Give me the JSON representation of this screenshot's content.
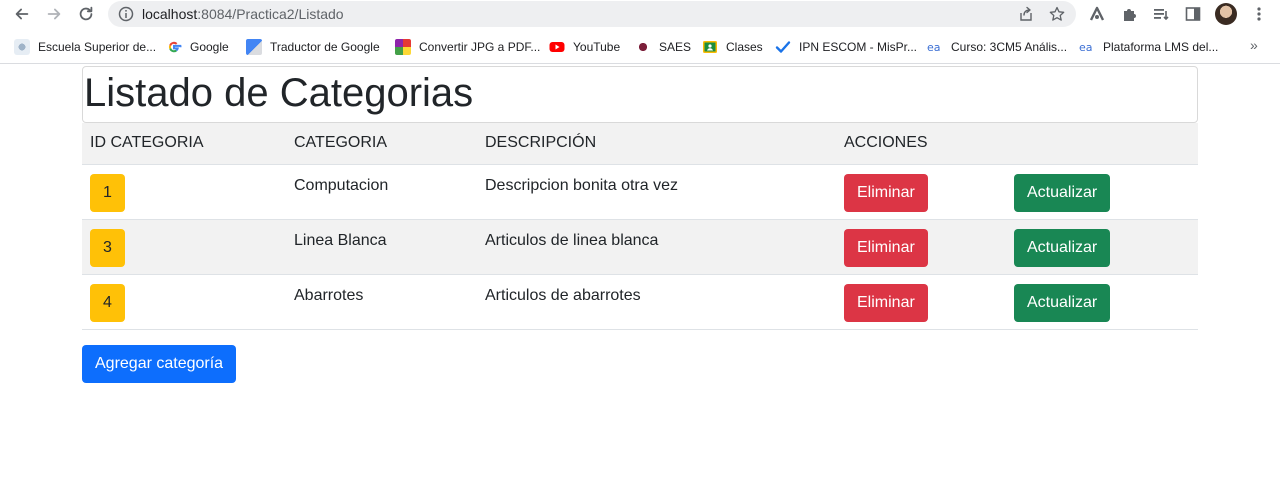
{
  "browser": {
    "url_host": "localhost",
    "url_path": ":8084/Practica2/Listado"
  },
  "bookmarks": [
    {
      "label": "Escuela Superior de..."
    },
    {
      "label": "Google"
    },
    {
      "label": "Traductor de Google"
    },
    {
      "label": "Convertir JPG a PDF..."
    },
    {
      "label": "YouTube"
    },
    {
      "label": "SAES"
    },
    {
      "label": "Clases"
    },
    {
      "label": "IPN ESCOM - MisPr..."
    },
    {
      "label": "Curso: 3CM5 Anális..."
    },
    {
      "label": "Plataforma LMS del..."
    }
  ],
  "bookmarks_more": "»",
  "page": {
    "title": "Listado de Categorias",
    "columns": [
      "ID CATEGORIA",
      "CATEGORIA",
      "DESCRIPCIÓN",
      "ACCIONES",
      ""
    ],
    "rows": [
      {
        "id": "1",
        "categoria": "Computacion",
        "descripcion": "Descripcion bonita otra vez",
        "delete": "Eliminar",
        "update": "Actualizar"
      },
      {
        "id": "3",
        "categoria": "Linea Blanca",
        "descripcion": "Articulos de linea blanca",
        "delete": "Eliminar",
        "update": "Actualizar"
      },
      {
        "id": "4",
        "categoria": "Abarrotes",
        "descripcion": "Articulos de abarrotes",
        "delete": "Eliminar",
        "update": "Actualizar"
      }
    ],
    "add_label": "Agregar categoría"
  },
  "colors": {
    "warning": "#ffc107",
    "danger": "#dc3545",
    "success": "#198754",
    "primary": "#0d6efd"
  }
}
